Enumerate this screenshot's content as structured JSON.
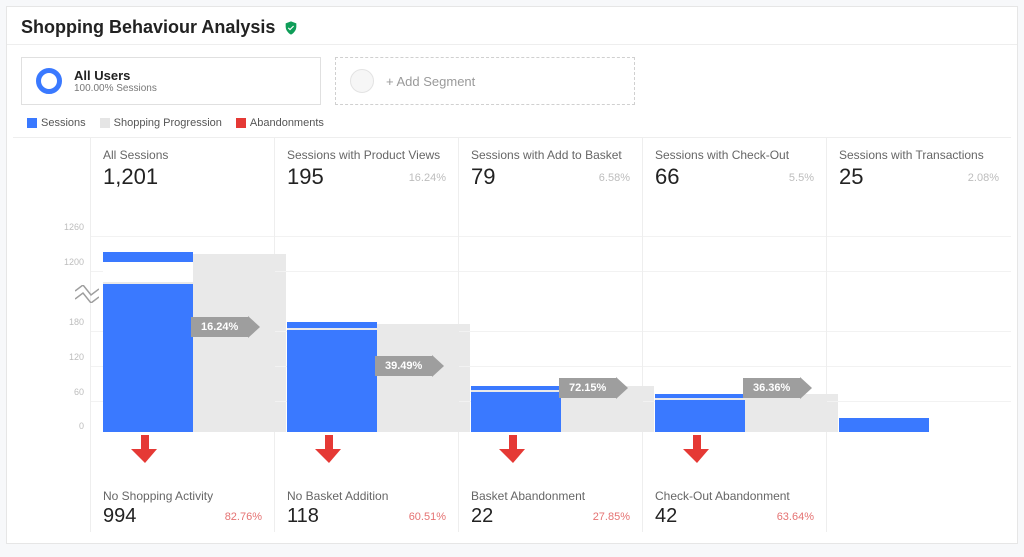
{
  "header": {
    "title": "Shopping Behaviour Analysis"
  },
  "segments": {
    "primary": {
      "title": "All Users",
      "subtitle": "100.00% Sessions"
    },
    "add_label": "+ Add Segment"
  },
  "legend": {
    "sessions": "Sessions",
    "progression": "Shopping Progression",
    "abandonments": "Abandonments"
  },
  "axis": {
    "ticks": [
      0,
      60,
      120,
      180,
      1200,
      1260
    ]
  },
  "stages": [
    {
      "label": "All Sessions",
      "value_fmt": "1,201",
      "pct": "",
      "progress_pct": "16.24%"
    },
    {
      "label": "Sessions with Product Views",
      "value_fmt": "195",
      "pct": "16.24%",
      "progress_pct": "39.49%"
    },
    {
      "label": "Sessions with Add to Basket",
      "value_fmt": "79",
      "pct": "6.58%",
      "progress_pct": "72.15%"
    },
    {
      "label": "Sessions with Check-Out",
      "value_fmt": "66",
      "pct": "5.5%",
      "progress_pct": "36.36%"
    },
    {
      "label": "Sessions with Transactions",
      "value_fmt": "25",
      "pct": "2.08%",
      "progress_pct": ""
    }
  ],
  "abandonments": [
    {
      "label": "No Shopping Activity",
      "value_fmt": "994",
      "pct": "82.76%"
    },
    {
      "label": "No Basket Addition",
      "value_fmt": "118",
      "pct": "60.51%"
    },
    {
      "label": "Basket Abandonment",
      "value_fmt": "22",
      "pct": "27.85%"
    },
    {
      "label": "Check-Out Abandonment",
      "value_fmt": "42",
      "pct": "63.64%"
    },
    {
      "label": "",
      "value_fmt": "",
      "pct": ""
    }
  ],
  "colors": {
    "sessions": "#3a79ff",
    "progression": "#e5e5e5",
    "abandonment": "#e53935"
  },
  "chart_data": {
    "type": "bar",
    "title": "Shopping Behaviour Analysis",
    "ylabel": "Sessions",
    "ylim_segments": [
      [
        0,
        240
      ],
      [
        1190,
        1280
      ]
    ],
    "stages": [
      {
        "name": "All Sessions",
        "sessions": 1201,
        "pct_of_all": 100.0,
        "progress_to_next_pct": 16.24
      },
      {
        "name": "Sessions with Product Views",
        "sessions": 195,
        "pct_of_all": 16.24,
        "progress_to_next_pct": 39.49
      },
      {
        "name": "Sessions with Add to Basket",
        "sessions": 79,
        "pct_of_all": 6.58,
        "progress_to_next_pct": 72.15
      },
      {
        "name": "Sessions with Check-Out",
        "sessions": 66,
        "pct_of_all": 5.5,
        "progress_to_next_pct": 36.36
      },
      {
        "name": "Sessions with Transactions",
        "sessions": 25,
        "pct_of_all": 2.08,
        "progress_to_next_pct": null
      }
    ],
    "abandonments": [
      {
        "name": "No Shopping Activity",
        "count": 994,
        "rate_pct": 82.76
      },
      {
        "name": "No Basket Addition",
        "count": 118,
        "rate_pct": 60.51
      },
      {
        "name": "Basket Abandonment",
        "count": 22,
        "rate_pct": 27.85
      },
      {
        "name": "Check-Out Abandonment",
        "count": 42,
        "rate_pct": 63.64
      }
    ],
    "y_ticks": [
      0,
      60,
      120,
      180,
      1200,
      1260
    ]
  }
}
